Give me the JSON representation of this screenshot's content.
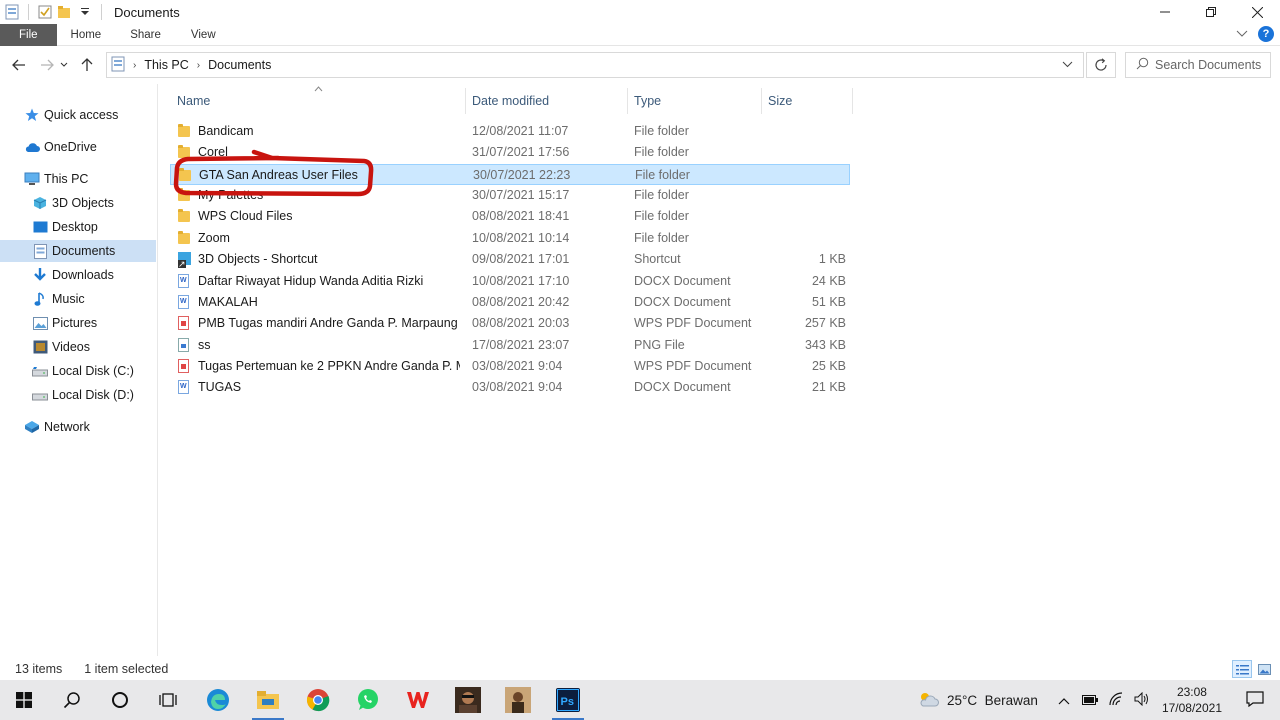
{
  "window": {
    "title": "Documents"
  },
  "ribbon": {
    "tabs": [
      "File",
      "Home",
      "Share",
      "View"
    ],
    "help": "?"
  },
  "address": {
    "crumbs": [
      "This PC",
      "Documents"
    ]
  },
  "search": {
    "placeholder": "Search Documents"
  },
  "nav_pane": {
    "items": [
      {
        "label": "Quick access",
        "icon": "star-icon"
      },
      {
        "label": "OneDrive",
        "icon": "cloud-icon"
      },
      {
        "label": "This PC",
        "icon": "computer-icon"
      },
      {
        "label": "3D Objects",
        "icon": "cube-icon"
      },
      {
        "label": "Desktop",
        "icon": "desktop-icon"
      },
      {
        "label": "Documents",
        "icon": "documents-icon",
        "selected": true
      },
      {
        "label": "Downloads",
        "icon": "download-icon"
      },
      {
        "label": "Music",
        "icon": "music-icon"
      },
      {
        "label": "Pictures",
        "icon": "pictures-icon"
      },
      {
        "label": "Videos",
        "icon": "videos-icon"
      },
      {
        "label": "Local Disk (C:)",
        "icon": "drive-icon"
      },
      {
        "label": "Local Disk (D:)",
        "icon": "drive-icon"
      },
      {
        "label": "Network",
        "icon": "network-icon"
      }
    ]
  },
  "columns": {
    "name": "Name",
    "date": "Date modified",
    "type": "Type",
    "size": "Size"
  },
  "files": [
    {
      "name": "Bandicam",
      "date": "12/08/2021 11:07",
      "type": "File folder",
      "size": "",
      "kind": "folder"
    },
    {
      "name": "Corel",
      "date": "31/07/2021 17:56",
      "type": "File folder",
      "size": "",
      "kind": "folder"
    },
    {
      "name": "GTA San Andreas User Files",
      "date": "30/07/2021 22:23",
      "type": "File folder",
      "size": "",
      "kind": "folder",
      "selected": true
    },
    {
      "name": "My Palettes",
      "date": "30/07/2021 15:17",
      "type": "File folder",
      "size": "",
      "kind": "folder"
    },
    {
      "name": "WPS Cloud Files",
      "date": "08/08/2021 18:41",
      "type": "File folder",
      "size": "",
      "kind": "folder"
    },
    {
      "name": "Zoom",
      "date": "10/08/2021 10:14",
      "type": "File folder",
      "size": "",
      "kind": "folder"
    },
    {
      "name": "3D Objects - Shortcut",
      "date": "09/08/2021 17:01",
      "type": "Shortcut",
      "size": "1 KB",
      "kind": "shortcut"
    },
    {
      "name": "Daftar Riwayat Hidup Wanda Aditia Rizki",
      "date": "10/08/2021 17:10",
      "type": "DOCX Document",
      "size": "24 KB",
      "kind": "docx"
    },
    {
      "name": "MAKALAH",
      "date": "08/08/2021 20:42",
      "type": "DOCX Document",
      "size": "51 KB",
      "kind": "docx"
    },
    {
      "name": "PMB Tugas mandiri Andre Ganda P. Marpaung",
      "date": "08/08/2021 20:03",
      "type": "WPS PDF Document",
      "size": "257 KB",
      "kind": "pdf"
    },
    {
      "name": "ss",
      "date": "17/08/2021 23:07",
      "type": "PNG File",
      "size": "343 KB",
      "kind": "png"
    },
    {
      "name": "Tugas Pertemuan ke 2 PPKN Andre Ganda P. M...",
      "date": "03/08/2021 9:04",
      "type": "WPS PDF Document",
      "size": "25 KB",
      "kind": "pdf"
    },
    {
      "name": "TUGAS",
      "date": "03/08/2021 9:04",
      "type": "DOCX Document",
      "size": "21 KB",
      "kind": "docx"
    }
  ],
  "status": {
    "count": "13 items",
    "selected": "1 item selected"
  },
  "taskbar": {
    "apps": [
      "start-icon",
      "search-icon",
      "cortana-icon",
      "task-view-icon",
      "edge-icon",
      "file-explorer-icon",
      "chrome-icon",
      "whatsapp-icon",
      "wps-icon",
      "game-icon",
      "game-icon-2",
      "photoshop-icon"
    ],
    "weather": "25°C  Berawan",
    "time": "23:08",
    "date": "17/08/2021"
  },
  "colors": {
    "selection": "#cce8ff",
    "annotation": "#c8140f",
    "accent": "#1a73d9"
  }
}
